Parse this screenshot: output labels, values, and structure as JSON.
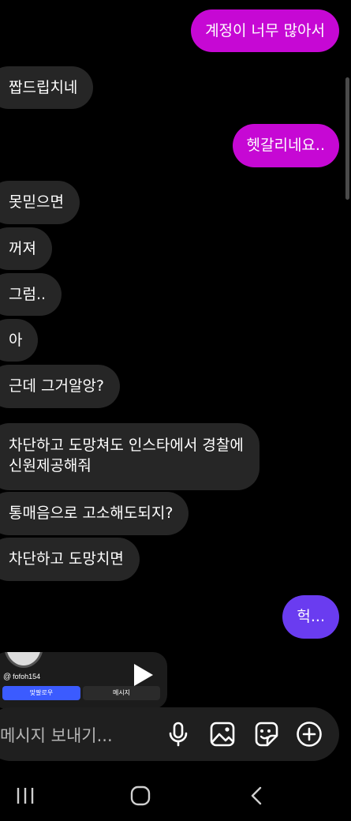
{
  "messages": [
    {
      "side": "sent",
      "text": "계정이 너무 많아서",
      "color": "#c608d4"
    },
    {
      "side": "received",
      "text": "짭드립치네"
    },
    {
      "side": "sent",
      "text": "헷갈리네요..",
      "color": "#c608d4"
    },
    {
      "side": "received",
      "text": "못믿으면"
    },
    {
      "side": "received",
      "text": "꺼져"
    },
    {
      "side": "received",
      "text": "그럼.."
    },
    {
      "side": "received",
      "text": "아"
    },
    {
      "side": "received",
      "text": "근데 그거알앙?"
    },
    {
      "side": "received",
      "lines": [
        "차단하고 도망쳐도 인스타에서 경찰에",
        "신원제공해줘"
      ]
    },
    {
      "side": "received",
      "text": "통매음으로 고소해도되지?"
    },
    {
      "side": "received",
      "text": "차단하고 도망치면"
    },
    {
      "side": "sent",
      "text": "헉...",
      "color": "#6a3cf0"
    }
  ],
  "shared_post": {
    "username": "fofoh154",
    "follow_label": "맞팔로우",
    "message_label": "메시지"
  },
  "composer": {
    "placeholder": "메시지 보내기...",
    "icons": [
      "microphone-icon",
      "image-icon",
      "sticker-icon",
      "plus-icon"
    ]
  },
  "system_nav": {
    "icons": [
      "recent-apps-icon",
      "home-icon",
      "back-icon"
    ]
  }
}
